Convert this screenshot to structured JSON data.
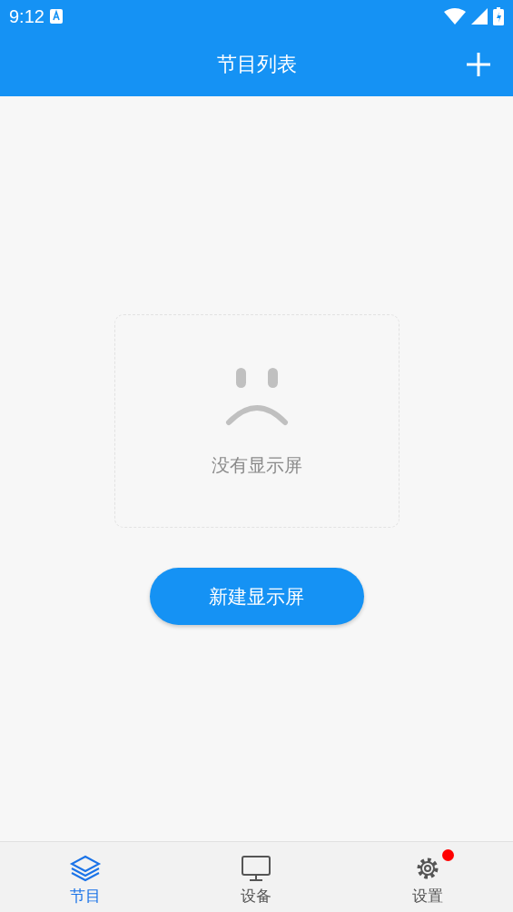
{
  "status_bar": {
    "time": "9:12"
  },
  "app_bar": {
    "title": "节目列表"
  },
  "empty_state": {
    "message": "没有显示屏"
  },
  "primary_button": {
    "label": "新建显示屏"
  },
  "bottom_nav": [
    {
      "label": "节目",
      "kind": "layers",
      "selected": true,
      "badge": false
    },
    {
      "label": "设备",
      "kind": "monitor",
      "selected": false,
      "badge": false
    },
    {
      "label": "设置",
      "kind": "gear",
      "selected": false,
      "badge": true
    }
  ]
}
